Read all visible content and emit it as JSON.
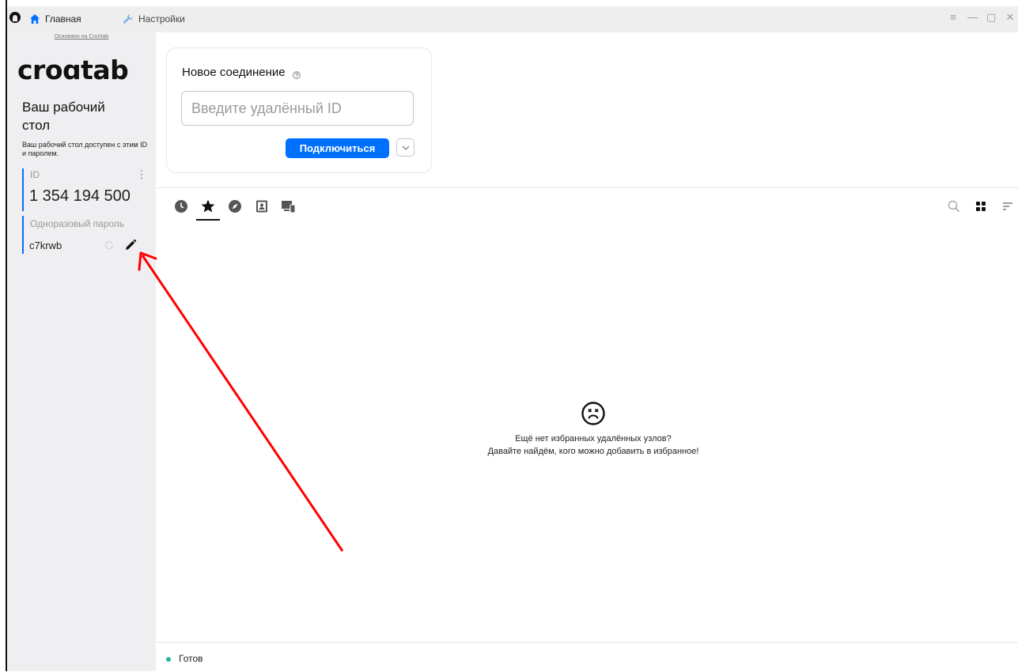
{
  "titlebar": {
    "tabs": [
      {
        "label": "Главная",
        "icon": "home-icon",
        "icon_color": "#0071ff"
      },
      {
        "label": "Настройки",
        "icon": "wrench-icon",
        "icon_color": "#6aa7e6"
      }
    ],
    "window_controls": [
      "≡",
      "—",
      "▢",
      "✕"
    ]
  },
  "sidebar": {
    "based_on": "Основано на Crontab",
    "brand": "croɑtab",
    "title": "Ваш рабочий стол",
    "description": "Ваш рабочий стол доступен с этим ID и паролем.",
    "id_label": "ID",
    "id_menu": "⋮",
    "id_value": "1 354 194 500",
    "password_label": "Одноразовый пароль",
    "password_value": "c7krwb"
  },
  "connection": {
    "title": "Новое соединение",
    "input_placeholder": "Введите удалённый ID",
    "connect_label": "Подключиться"
  },
  "peer_tabs": [
    {
      "icon": "clock-icon",
      "active": false
    },
    {
      "icon": "star-icon",
      "active": true
    },
    {
      "icon": "compass-icon",
      "active": false
    },
    {
      "icon": "address-book-icon",
      "active": false
    },
    {
      "icon": "devices-icon",
      "active": false
    }
  ],
  "empty_state": {
    "line1": "Ещё нет избранных удалённых узлов?",
    "line2": "Давайте найдём, кого можно добавить в избранное!"
  },
  "status": {
    "text": "Готов",
    "color": "#22b8a0"
  },
  "colors": {
    "accent": "#0071ff",
    "annotation_arrow": "#ff0000"
  }
}
